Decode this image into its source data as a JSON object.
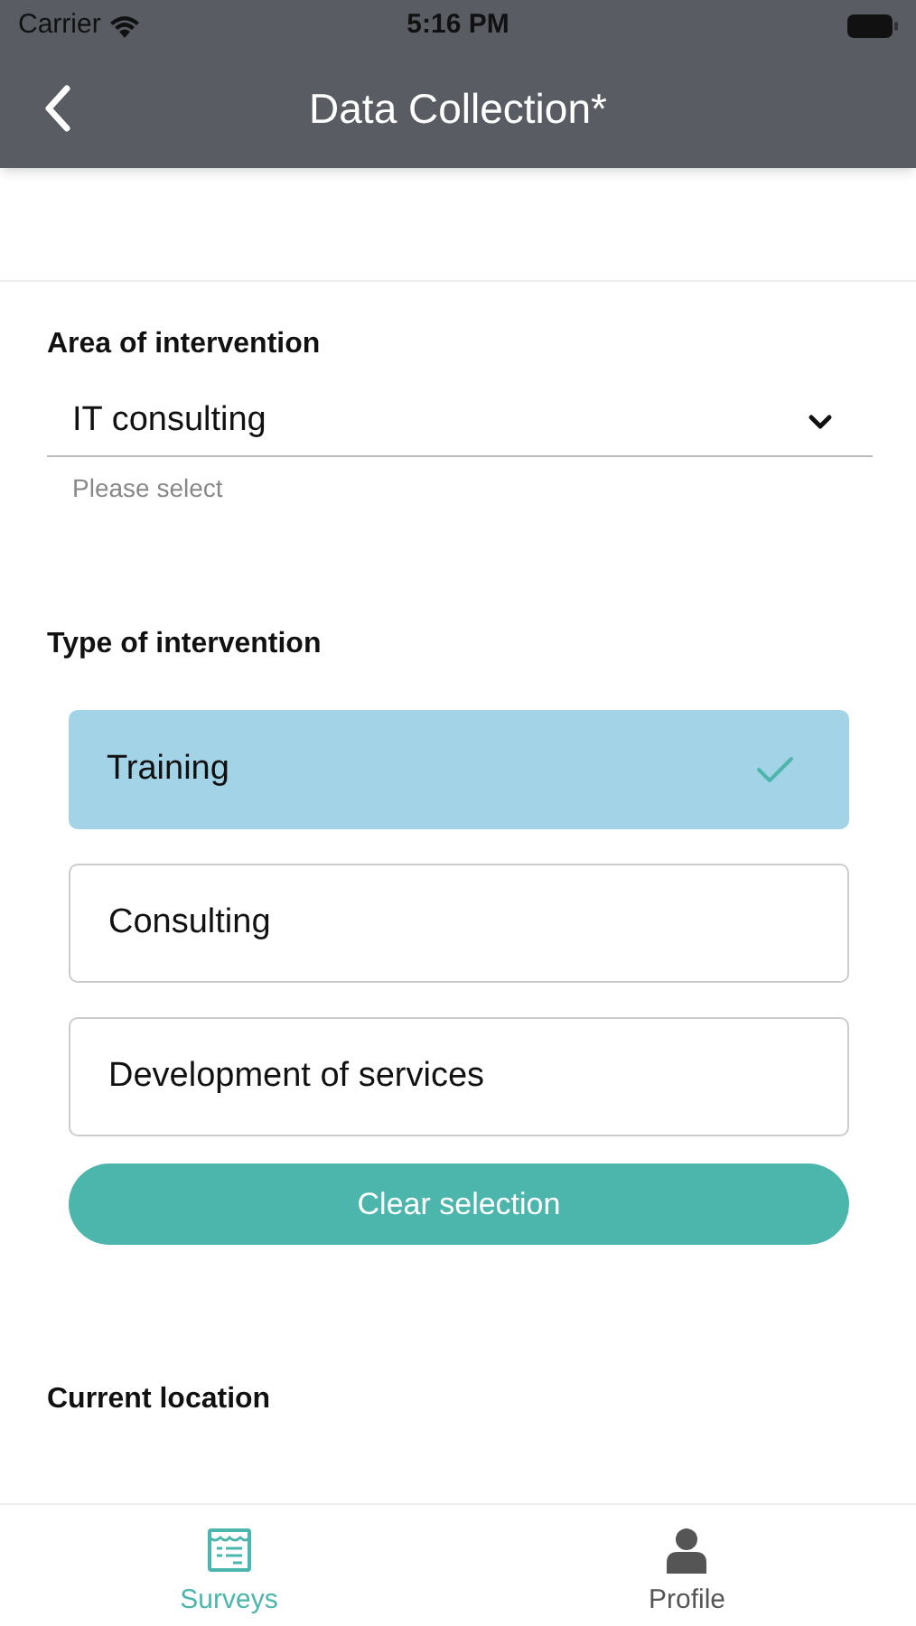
{
  "status_bar": {
    "carrier": "Carrier",
    "time": "5:16 PM"
  },
  "header": {
    "title": "Data Collection*"
  },
  "area_of_intervention": {
    "label": "Area of intervention",
    "value": "IT consulting",
    "helper_text": "Please select"
  },
  "type_of_intervention": {
    "label": "Type of intervention",
    "options": [
      {
        "label": "Training",
        "selected": true
      },
      {
        "label": "Consulting",
        "selected": false
      },
      {
        "label": "Development of services",
        "selected": false
      }
    ],
    "clear_button": "Clear selection"
  },
  "current_location": {
    "label": "Current location"
  },
  "tab_bar": [
    {
      "label": "Surveys",
      "kind": "surveys",
      "selected": true
    },
    {
      "label": "Profile",
      "kind": "profile",
      "selected": false
    }
  ]
}
